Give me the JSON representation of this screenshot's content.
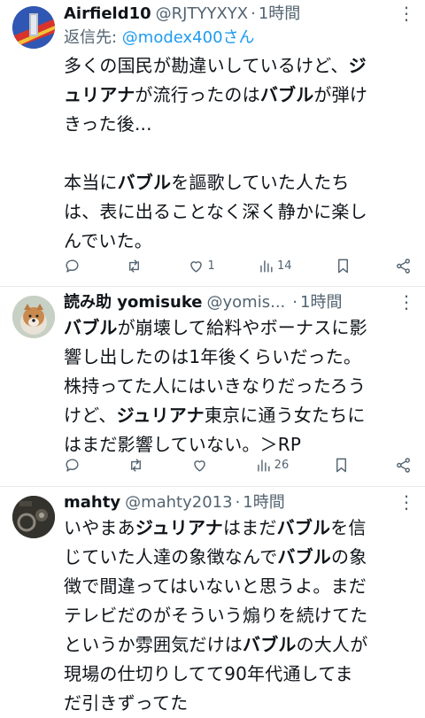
{
  "tweets": [
    {
      "name": "Airfield10",
      "handle": "@RJTYYXYX",
      "dot": "·",
      "time": "1時間",
      "more": "⋮",
      "reply_prefix": "返信先: ",
      "reply_handle": "@modex400さん",
      "lines": [
        [
          {
            "t": "多くの国民が勘違いしているけど、"
          },
          {
            "t": "ジ",
            "b": true
          }
        ],
        [
          {
            "t": "ュリアナ",
            "b": true
          },
          {
            "t": "が流行ったのは"
          },
          {
            "t": "バブル",
            "b": true
          },
          {
            "t": "が弾け"
          }
        ],
        [
          {
            "t": "きった後..."
          }
        ],
        [
          {
            "t": " "
          }
        ],
        [
          {
            "t": "本当に"
          },
          {
            "t": "バブル",
            "b": true
          },
          {
            "t": "を謳歌していた人たち"
          }
        ],
        [
          {
            "t": "は、表に出ることなく深く静かに楽し"
          }
        ],
        [
          {
            "t": "んでいた。"
          }
        ]
      ],
      "actions": {
        "reply": "",
        "retweet": "",
        "like": "1",
        "views": "14"
      }
    },
    {
      "name": "読み助 yomisuke",
      "handle": "@yomis...",
      "dot": "·",
      "time": "1時間",
      "more": "⋮",
      "lines": [
        [
          {
            "t": "バブル",
            "b": true
          },
          {
            "t": "が崩壊して給料やボーナスに影"
          }
        ],
        [
          {
            "t": "響し出したのは1年後くらいだった。"
          }
        ],
        [
          {
            "t": "株持ってた人にはいきなりだったろう"
          }
        ],
        [
          {
            "t": "けど、"
          },
          {
            "t": "ジュリアナ",
            "b": true
          },
          {
            "t": "東京に通う女たちに"
          }
        ],
        [
          {
            "t": "はまだ影響していない。＞RP"
          }
        ]
      ],
      "actions": {
        "reply": "",
        "retweet": "",
        "like": "",
        "views": "26"
      }
    },
    {
      "name": "mahty",
      "handle": "@mahty2013",
      "dot": "·",
      "time": "1時間",
      "more": "⋮",
      "lines": [
        [
          {
            "t": "いやまあ"
          },
          {
            "t": "ジュリアナ",
            "b": true
          },
          {
            "t": "はまだ"
          },
          {
            "t": "バブル",
            "b": true
          },
          {
            "t": "を信"
          }
        ],
        [
          {
            "t": "じていた人達の象徴なんで"
          },
          {
            "t": "バブル",
            "b": true
          },
          {
            "t": "の象"
          }
        ],
        [
          {
            "t": "徴で間違ってはいないと思うよ。まだ"
          }
        ],
        [
          {
            "t": "テレビだのがそういう煽りを続けてた"
          }
        ],
        [
          {
            "t": "というか雰囲気だけは"
          },
          {
            "t": "バブル",
            "b": true
          },
          {
            "t": "の大人が"
          }
        ],
        [
          {
            "t": "現場の仕切りしてて90年代通してま"
          }
        ],
        [
          {
            "t": "だ引きずってた"
          }
        ]
      ]
    }
  ],
  "colors": {
    "text": "#0f1419",
    "muted": "#536471",
    "link": "#1d9bf0",
    "border": "#e6e9ec"
  }
}
